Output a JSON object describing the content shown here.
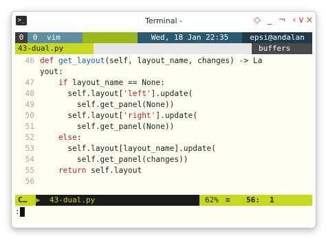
{
  "window": {
    "title": "Terminal -",
    "app_icon": ">_",
    "buttons": [
      "◇",
      "_",
      "¬",
      "‹",
      "∨",
      "×"
    ]
  },
  "tabline": {
    "mode_count_1": "0",
    "mode_count_2": "0",
    "app": "vim",
    "date": "Wed, 18 Jan 22:35",
    "user": "epsi@andalan"
  },
  "bufline": {
    "filename": "43-dual.py",
    "label": "buffers"
  },
  "code": {
    "lines": [
      {
        "num": "46",
        "parts": [
          [
            "kw",
            "def "
          ],
          [
            "fn",
            "get_layout"
          ],
          [
            "tx",
            "(self, layout_name, changes) -> La"
          ]
        ]
      },
      {
        "num": "",
        "parts": [
          [
            "tx",
            "yout:"
          ]
        ]
      },
      {
        "num": "47",
        "parts": [
          [
            "kw",
            "    if "
          ],
          [
            "tx",
            "layout_name == None:"
          ]
        ]
      },
      {
        "num": "48",
        "parts": [
          [
            "tx",
            "      self.layout["
          ],
          [
            "str",
            "'left'"
          ],
          [
            "tx",
            "].update("
          ]
        ]
      },
      {
        "num": "49",
        "parts": [
          [
            "tx",
            "        self.get_panel(None))"
          ]
        ]
      },
      {
        "num": "50",
        "parts": [
          [
            "tx",
            "      self.layout["
          ],
          [
            "str",
            "'right'"
          ],
          [
            "tx",
            "].update("
          ]
        ]
      },
      {
        "num": "51",
        "parts": [
          [
            "tx",
            "        self.get_panel(None))"
          ]
        ]
      },
      {
        "num": "52",
        "parts": [
          [
            "kw",
            "    else"
          ],
          [
            "tx",
            ":"
          ]
        ]
      },
      {
        "num": "53",
        "parts": [
          [
            "tx",
            "      self.layout[layout_name].update("
          ]
        ]
      },
      {
        "num": "54",
        "parts": [
          [
            "tx",
            "        self.get_panel(changes))"
          ]
        ]
      },
      {
        "num": "55",
        "parts": [
          [
            "kw",
            "    return "
          ],
          [
            "tx",
            "self.layout"
          ]
        ]
      },
      {
        "num": "56",
        "parts": [
          [
            "tx",
            ""
          ]
        ]
      }
    ]
  },
  "status": {
    "mode": "C…",
    "filename": "43-dual.py",
    "percent": "62%",
    "menu_icon": "≡",
    "line": "56:",
    "col": "1"
  },
  "cmdline": {
    "text": ":"
  }
}
